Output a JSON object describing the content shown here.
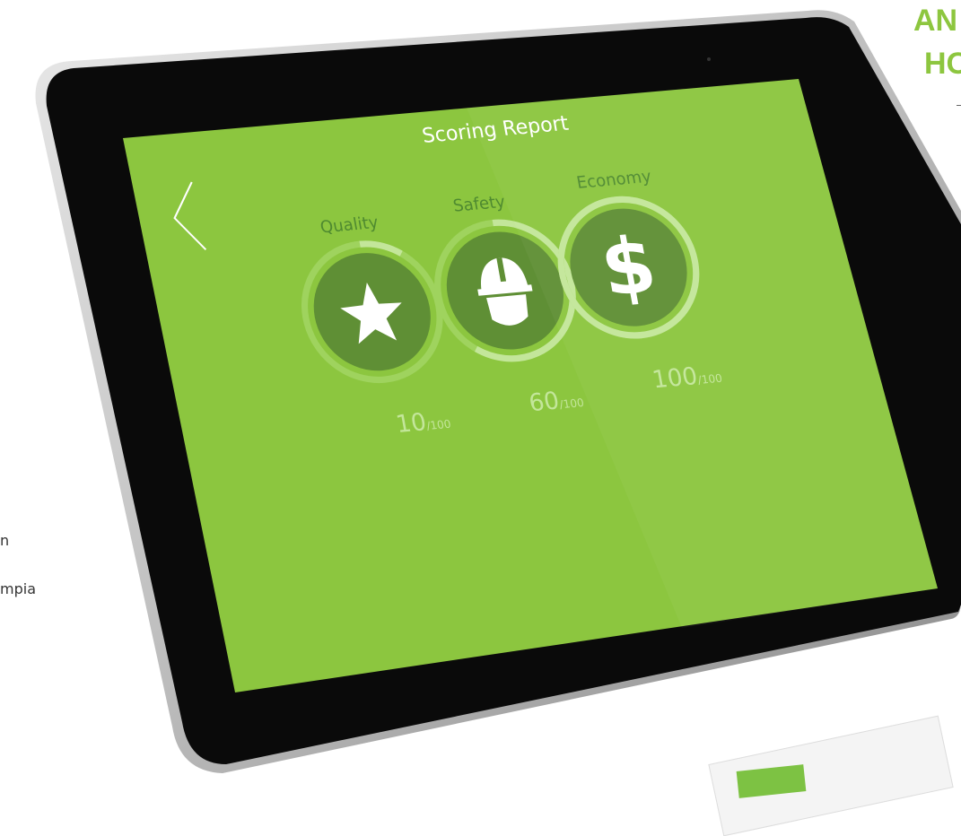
{
  "background": {
    "heading_line1": "AN",
    "heading_line2": "HO",
    "side_text_1": "n",
    "side_text_2": "mpia"
  },
  "screen": {
    "title": "Scoring Report",
    "back_icon": "chevron-left-icon",
    "colors": {
      "screen": "#8cc63f",
      "circle": "#5f8f35",
      "ring_track": "#9fd35e",
      "ring_progress": "#c3e69a",
      "label": "#4f8a30"
    },
    "metrics": [
      {
        "label": "Quality",
        "icon": "star-icon",
        "score": "10",
        "max": "/100",
        "progress": 0.1
      },
      {
        "label": "Safety",
        "icon": "hard-hat-icon",
        "score": "60",
        "max": "/100",
        "progress": 0.6
      },
      {
        "label": "Economy",
        "icon": "dollar-icon",
        "score": "100",
        "max": "/100",
        "progress": 1.0
      }
    ]
  }
}
